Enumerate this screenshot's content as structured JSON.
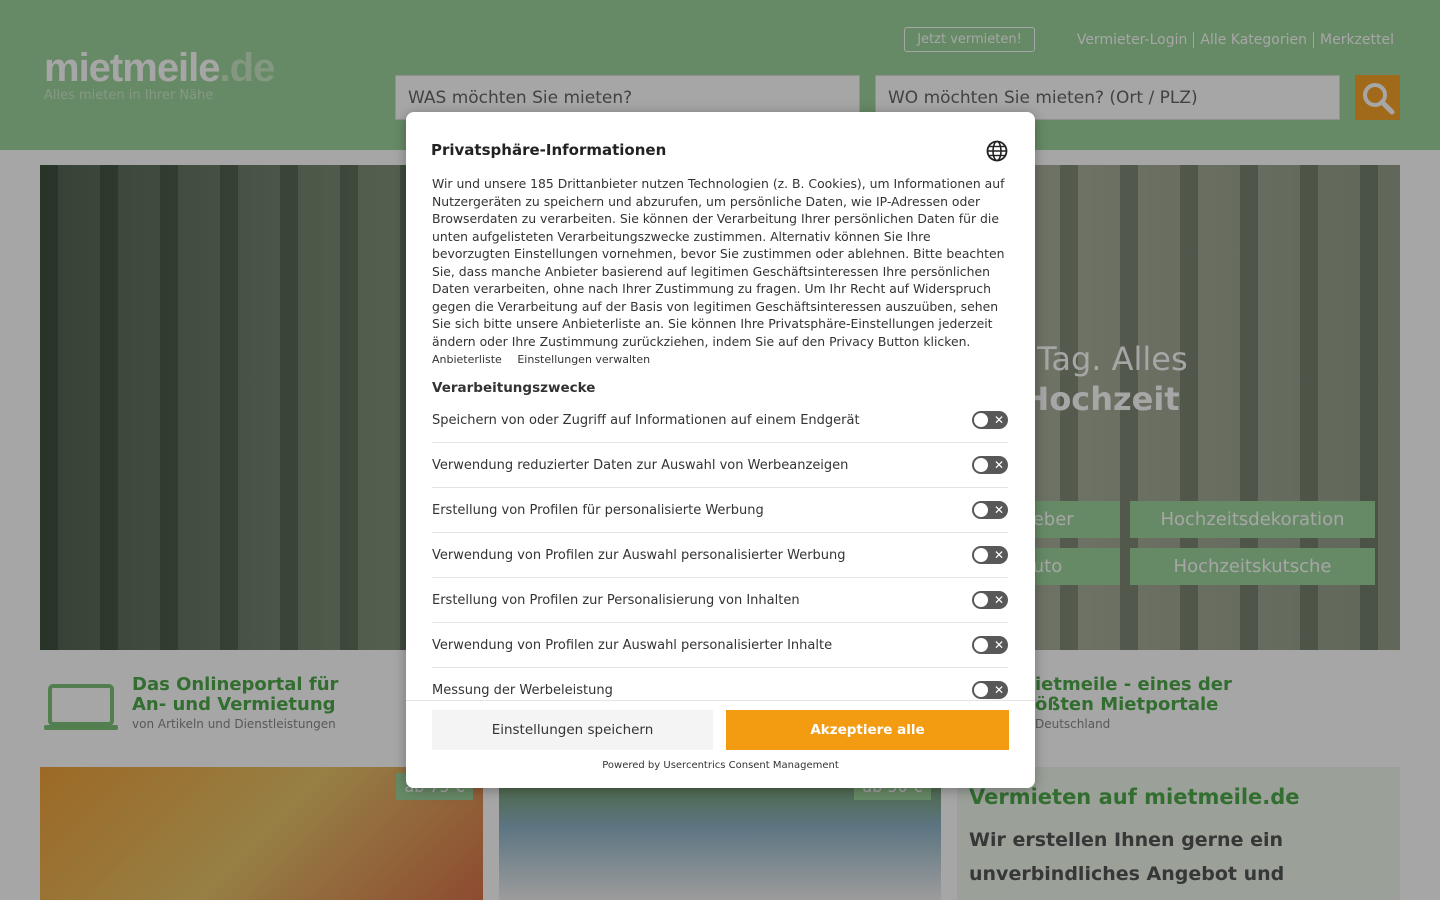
{
  "header": {
    "logo_main": "mietmeile",
    "logo_tld": ".de",
    "logo_sub": "Alles mieten in Ihrer Nähe",
    "cta_button": "Jetzt vermieten!",
    "nav": [
      "Vermieter-Login",
      "Alle Kategorien",
      "Merkzettel"
    ],
    "search_what_placeholder": "WAS möchten Sie mieten?",
    "search_where_placeholder": "WO möchten Sie mieten? (Ort / PLZ)"
  },
  "hero": {
    "line1": "chönsten Tag. Alles",
    "line2": "erfekte Hochzeit",
    "buttons": [
      "geber",
      "Hochzeitsdekoration",
      "uto",
      "Hochzeitskutsche"
    ]
  },
  "features": [
    {
      "title1": "Das Onlineportal für",
      "title2": "An- und Vermietung",
      "sub": "von Artikeln und Dienstleistungen"
    },
    {
      "title1": "ietmeile - eines der",
      "title2": "ößten Mietportale",
      "sub": "Deutschland"
    }
  ],
  "cards": [
    {
      "price": "ab 75 €"
    },
    {
      "price": "ab 50 €"
    }
  ],
  "offer": {
    "title": "Vermieten auf mietmeile.de",
    "text": "Wir erstellen Ihnen gerne ein unverbindliches Angebot und"
  },
  "consent": {
    "title": "Privatsphäre-Informationen",
    "intro": "Wir und unsere 185 Drittanbieter nutzen Technologien (z. B. Cookies), um Informationen auf Nutzergeräten zu speichern und abzurufen, um persönliche Daten, wie IP-Adressen oder Browserdaten zu verarbeiten. Sie können der Verarbeitung Ihrer persönlichen Daten für die unten aufgelisteten Verarbeitungszwecke zustimmen. Alternativ können Sie Ihre bevorzugten Einstellungen vornehmen, bevor Sie zustimmen oder ablehnen. Bitte beachten Sie, dass manche Anbieter basierend auf legitimen Geschäftsinteressen Ihre persönlichen Daten verarbeiten, ohne nach Ihrer Zustimmung zu fragen. Um Ihr Recht auf Widerspruch gegen die Verarbeitung auf der Basis von legitimen Geschäftsinteressen auszuüben, sehen Sie sich bitte unsere Anbieterliste an. Sie können Ihre Privatsphäre-Einstellungen jederzeit ändern oder Ihre Zustimmung zurückziehen, indem Sie auf den Privacy Button klicken.",
    "link_vendors": "Anbieterliste",
    "link_settings": "Einstellungen verwalten",
    "section_title": "Verarbeitungszwecke",
    "purposes": [
      "Speichern von oder Zugriff auf Informationen auf einem Endgerät",
      "Verwendung reduzierter Daten zur Auswahl von Werbeanzeigen",
      "Erstellung von Profilen für personalisierte Werbung",
      "Verwendung von Profilen zur Auswahl personalisierter Werbung",
      "Erstellung von Profilen zur Personalisierung von Inhalten",
      "Verwendung von Profilen zur Auswahl personalisierter Inhalte",
      "Messung der Werbeleistung"
    ],
    "save_button": "Einstellungen speichern",
    "accept_button": "Akzeptiere alle",
    "powered_by": "Powered by Usercentrics Consent Management"
  }
}
